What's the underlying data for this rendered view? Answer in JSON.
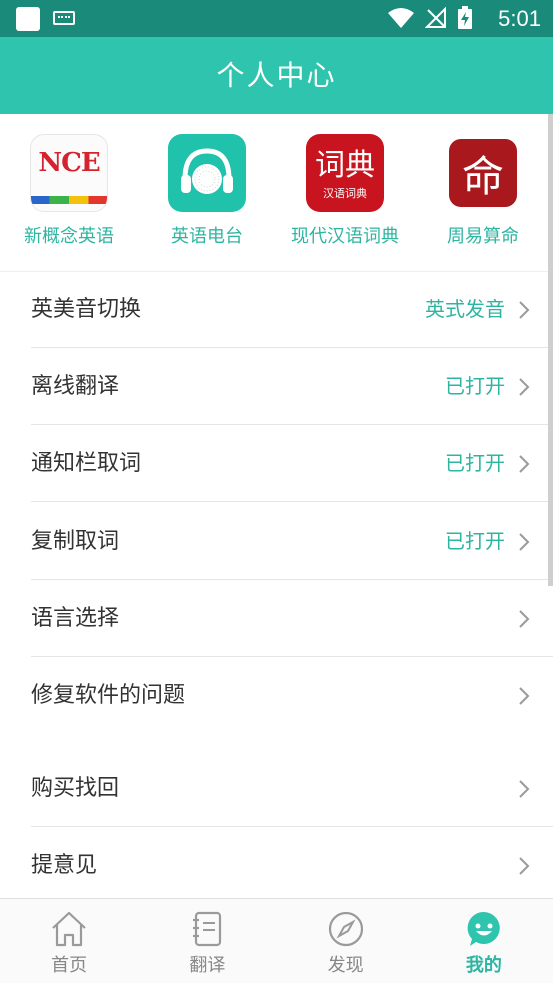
{
  "status_bar": {
    "time": "5:01"
  },
  "header": {
    "title": "个人中心"
  },
  "apps": [
    {
      "label": "新概念英语",
      "icon": "nce-app-icon",
      "icon_text": "NCE"
    },
    {
      "label": "英语电台",
      "icon": "radio-headphones-icon"
    },
    {
      "label": "现代汉语词典",
      "icon": "dictionary-app-icon",
      "icon_text": "词典",
      "icon_subtext": "汉语词典"
    },
    {
      "label": "周易算命",
      "icon": "fortune-app-icon",
      "icon_text": "命"
    }
  ],
  "settings": [
    {
      "label": "英美音切换",
      "value": "英式发音"
    },
    {
      "label": "离线翻译",
      "value": "已打开"
    },
    {
      "label": "通知栏取词",
      "value": "已打开"
    },
    {
      "label": "复制取词",
      "value": "已打开"
    },
    {
      "label": "语言选择",
      "value": ""
    },
    {
      "label": "修复软件的问题",
      "value": ""
    },
    {
      "label": "购买找回",
      "value": ""
    },
    {
      "label": "提意见",
      "value": ""
    }
  ],
  "tabs": [
    {
      "label": "首页",
      "icon": "home-icon",
      "active": false
    },
    {
      "label": "翻译",
      "icon": "notebook-icon",
      "active": false
    },
    {
      "label": "发现",
      "icon": "compass-icon",
      "active": false
    },
    {
      "label": "我的",
      "icon": "smiley-chat-icon",
      "active": true
    }
  ],
  "colors": {
    "accent": "#2ec4ad",
    "status_bar": "#1a8a7a",
    "label_accent": "#2eb5a2"
  }
}
